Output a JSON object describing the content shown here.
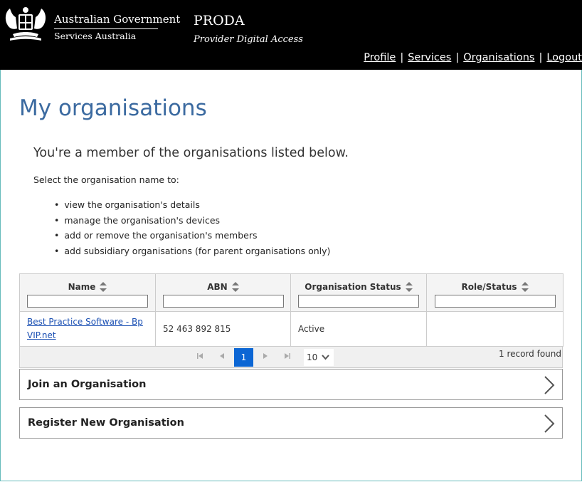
{
  "header": {
    "gov_name": "Australian Government",
    "gov_sub": "Services Australia",
    "app_title": "PRODA",
    "app_subtitle": "Provider Digital Access",
    "nav": [
      {
        "label": "Profile"
      },
      {
        "label": "Services"
      },
      {
        "label": "Organisations"
      },
      {
        "label": "Logout"
      }
    ],
    "nav_separator": "|"
  },
  "page": {
    "title": "My organisations",
    "lead": "You're a member of the organisations listed below.",
    "instruction": "Select the organisation name to:",
    "bullets": [
      "view the organisation's details",
      "manage the organisation's devices",
      "add or remove the organisation's members",
      "add subsidiary organisations (for parent organisations only)"
    ]
  },
  "table": {
    "columns": [
      {
        "label": "Name"
      },
      {
        "label": "ABN"
      },
      {
        "label": "Organisation Status"
      },
      {
        "label": "Role/Status"
      }
    ],
    "rows": [
      {
        "name_line1": "Best Practice Software - Bp",
        "name_line2": "VIP.net",
        "abn": "52 463 892 815",
        "status": "Active",
        "role": ""
      }
    ]
  },
  "pager": {
    "current_page": "1",
    "page_size": "10",
    "records": "1 record found"
  },
  "actions": [
    {
      "label": "Join an Organisation"
    },
    {
      "label": "Register New Organisation"
    }
  ],
  "colors": {
    "title": "#3b6aa0",
    "link": "#1a4fb3",
    "pager_active": "#0c66d4",
    "header_bg": "#000000"
  }
}
